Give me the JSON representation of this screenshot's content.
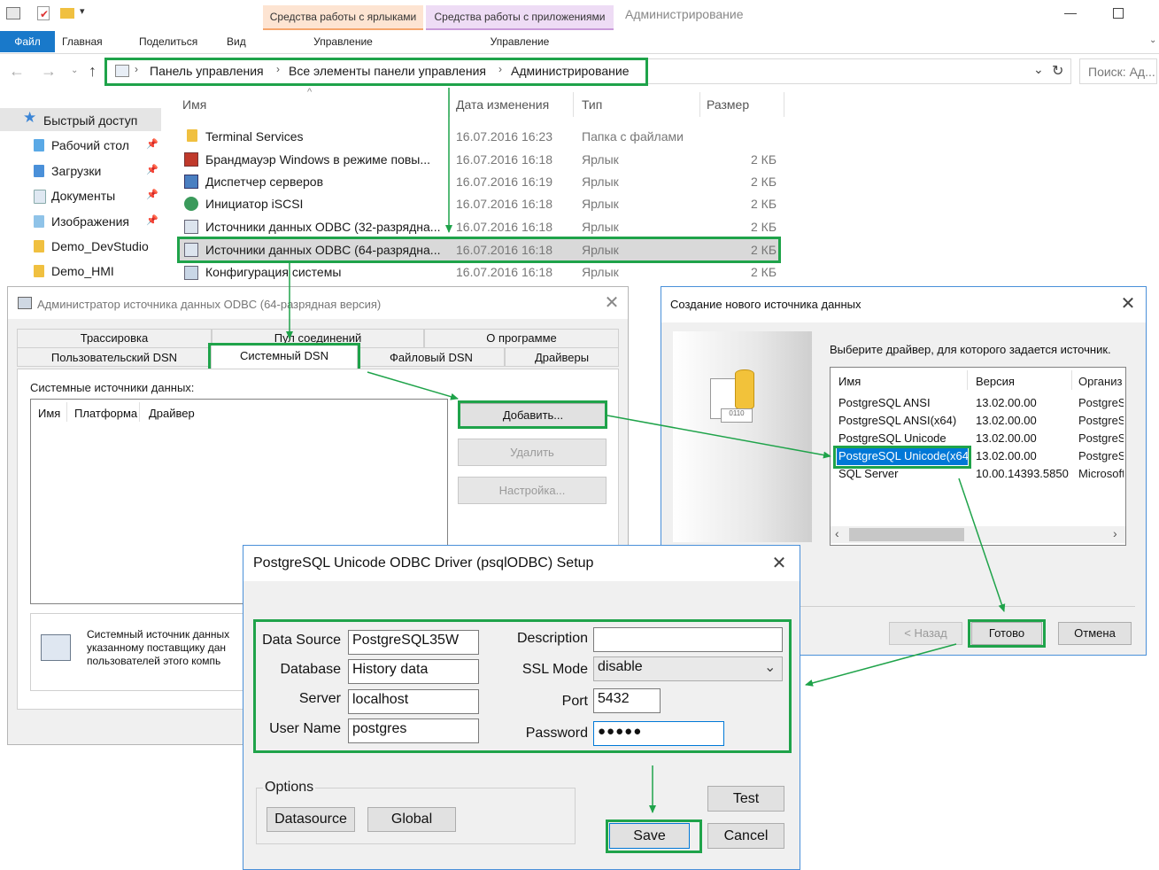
{
  "ribbon": {
    "context_tab_shortcuts": "Средства работы с ярлыками",
    "context_tab_apps": "Средства работы с приложениями",
    "window_title": "Администрирование",
    "tabs": [
      "Файл",
      "Главная",
      "Поделиться",
      "Вид"
    ],
    "manage_shortcuts": "Управление",
    "manage_apps": "Управление"
  },
  "address": {
    "crumbs": [
      "Панель управления",
      "Все элементы панели управления",
      "Администрирование"
    ],
    "search_placeholder": "Поиск: Ад..."
  },
  "columns": {
    "name": "Имя",
    "date": "Дата изменения",
    "type": "Тип",
    "size": "Размер"
  },
  "files": [
    {
      "name": "Terminal Services",
      "date": "16.07.2016 16:23",
      "type": "Папка с файлами",
      "size": ""
    },
    {
      "name": "Брандмауэр Windows в режиме повы...",
      "date": "16.07.2016 16:18",
      "type": "Ярлык",
      "size": "2 КБ"
    },
    {
      "name": "Диспетчер серверов",
      "date": "16.07.2016 16:19",
      "type": "Ярлык",
      "size": "2 КБ"
    },
    {
      "name": "Инициатор iSCSI",
      "date": "16.07.2016 16:18",
      "type": "Ярлык",
      "size": "2 КБ"
    },
    {
      "name": "Источники данных ODBC (32-разрядна...",
      "date": "16.07.2016 16:18",
      "type": "Ярлык",
      "size": "2 КБ"
    },
    {
      "name": "Источники данных ODBC (64-разрядна...",
      "date": "16.07.2016 16:18",
      "type": "Ярлык",
      "size": "2 КБ"
    },
    {
      "name": "Конфигурация системы",
      "date": "16.07.2016 16:18",
      "type": "Ярлык",
      "size": "2 КБ"
    }
  ],
  "sidebar": {
    "quick_access": "Быстрый доступ",
    "items": [
      "Рабочий стол",
      "Загрузки",
      "Документы",
      "Изображения",
      "Demo_DevStudio",
      "Demo_HMI"
    ]
  },
  "odbc_admin": {
    "title": "Администратор источника данных ODBC (64-разрядная версия)",
    "tabs_top": [
      "Трассировка",
      "Пул соединений",
      "О программе"
    ],
    "tabs_bottom": [
      "Пользовательский DSN",
      "Системный DSN",
      "Файловый DSN",
      "Драйверы"
    ],
    "list_label": "Системные источники данных:",
    "list_columns": [
      "Имя",
      "Платформа",
      "Драйвер"
    ],
    "add_button": "Добавить...",
    "remove_button": "Удалить",
    "configure_button": "Настройка...",
    "info_lines": [
      "Системный источник данных",
      "указанному поставщику дан",
      "пользователей этого компь"
    ]
  },
  "new_ds": {
    "title": "Создание нового источника данных",
    "prompt": "Выберите драйвер, для которого задается источник.",
    "columns": [
      "Имя",
      "Версия",
      "Организ"
    ],
    "drivers": [
      {
        "name": "PostgreSQL ANSI",
        "version": "13.02.00.00",
        "org": "PostgreS"
      },
      {
        "name": "PostgreSQL ANSI(x64)",
        "version": "13.02.00.00",
        "org": "PostgreS"
      },
      {
        "name": "PostgreSQL Unicode",
        "version": "13.02.00.00",
        "org": "PostgreS"
      },
      {
        "name": "PostgreSQL Unicode(x64)",
        "version": "13.02.00.00",
        "org": "PostgreS"
      },
      {
        "name": "SQL Server",
        "version": "10.00.14393.5850",
        "org": "Microsoft"
      }
    ],
    "back_button": "< Назад",
    "finish_button": "Готово",
    "cancel_button": "Отмена"
  },
  "setup": {
    "title": "PostgreSQL Unicode ODBC Driver (psqlODBC) Setup",
    "data_source_label": "Data Source",
    "data_source_value": "PostgreSQL35W",
    "database_label": "Database",
    "database_value": "History data",
    "server_label": "Server",
    "server_value": "localhost",
    "username_label": "User Name",
    "username_value": "postgres",
    "description_label": "Description",
    "description_value": "",
    "ssl_label": "SSL Mode",
    "ssl_value": "disable",
    "port_label": "Port",
    "port_value": "5432",
    "password_label": "Password",
    "password_value": "●●●●●",
    "options_label": "Options",
    "datasource_button": "Datasource",
    "global_button": "Global",
    "test_button": "Test",
    "save_button": "Save",
    "cancel_button": "Cancel"
  }
}
